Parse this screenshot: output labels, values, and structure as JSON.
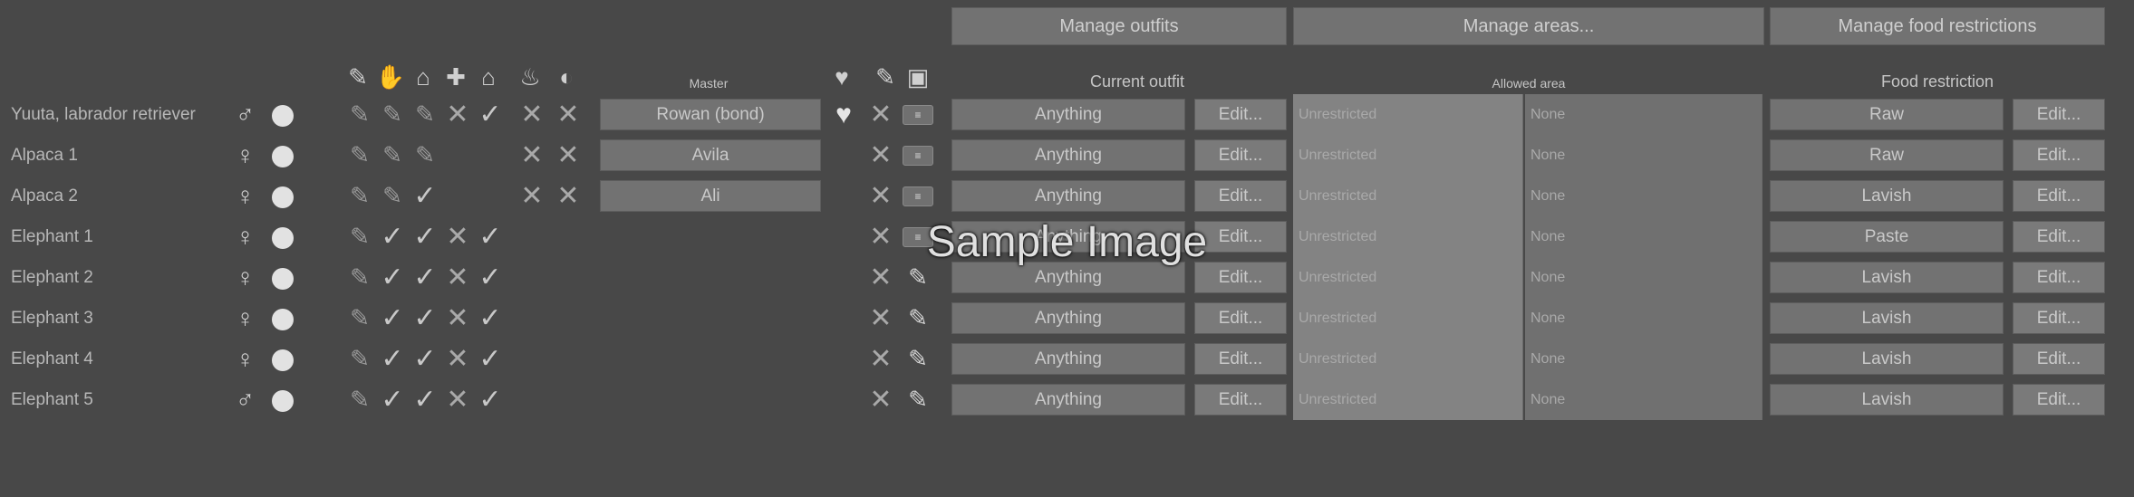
{
  "top_buttons": {
    "manage_outfits": "Manage outfits",
    "manage_areas": "Manage areas...",
    "manage_food": "Manage food restrictions"
  },
  "headers": {
    "master": "Master",
    "current_outfit": "Current outfit",
    "allowed_area": "Allowed area",
    "food_restriction": "Food restriction"
  },
  "header_icons": [
    "feather-icon",
    "hand-icon",
    "bed-icon",
    "plus-icon",
    "house-icon",
    "fire-icon",
    "egg-icon",
    "heart-icon",
    "pencil-icon",
    "tag-icon"
  ],
  "edit_label": "Edit...",
  "rows": [
    {
      "name": "Yuuta, labrador retriever",
      "gender": "♂",
      "marks": [
        "feather",
        "feather",
        "feather",
        "cross",
        "check",
        "cross",
        "cross"
      ],
      "master": "Rowan (bond)",
      "bond": true,
      "slaughter": "cross",
      "medical": "toggle",
      "outfit": "Anything",
      "area": "Unrestricted",
      "area_sub": "None",
      "food": "Raw"
    },
    {
      "name": "Alpaca 1",
      "gender": "♀",
      "marks": [
        "feather",
        "feather",
        "feather",
        "",
        "",
        "cross",
        "cross"
      ],
      "master": "Avila",
      "bond": false,
      "slaughter": "cross",
      "medical": "toggle",
      "outfit": "Anything",
      "area": "Unrestricted",
      "area_sub": "None",
      "food": "Raw"
    },
    {
      "name": "Alpaca 2",
      "gender": "♀",
      "marks": [
        "feather",
        "feather",
        "check",
        "",
        "",
        "cross",
        "cross"
      ],
      "master": "Ali",
      "bond": false,
      "slaughter": "cross",
      "medical": "toggle",
      "outfit": "Anything",
      "area": "Unrestricted",
      "area_sub": "None",
      "food": "Lavish"
    },
    {
      "name": "Elephant 1",
      "gender": "♀",
      "marks": [
        "feather",
        "check",
        "check",
        "cross",
        "check",
        "",
        ""
      ],
      "master": "",
      "bond": false,
      "slaughter": "cross",
      "medical": "toggle",
      "outfit": "Anything",
      "area": "Unrestricted",
      "area_sub": "None",
      "food": "Paste"
    },
    {
      "name": "Elephant 2",
      "gender": "♀",
      "marks": [
        "feather",
        "check",
        "check",
        "cross",
        "check",
        "",
        ""
      ],
      "master": "",
      "bond": false,
      "slaughter": "cross",
      "medical": "pen",
      "outfit": "Anything",
      "area": "Unrestricted",
      "area_sub": "None",
      "food": "Lavish"
    },
    {
      "name": "Elephant 3",
      "gender": "♀",
      "marks": [
        "feather",
        "check",
        "check",
        "cross",
        "check",
        "",
        ""
      ],
      "master": "",
      "bond": false,
      "slaughter": "cross",
      "medical": "pen",
      "outfit": "Anything",
      "area": "Unrestricted",
      "area_sub": "None",
      "food": "Lavish"
    },
    {
      "name": "Elephant 4",
      "gender": "♀",
      "marks": [
        "feather",
        "check",
        "check",
        "cross",
        "check",
        "",
        ""
      ],
      "master": "",
      "bond": false,
      "slaughter": "cross",
      "medical": "pen",
      "outfit": "Anything",
      "area": "Unrestricted",
      "area_sub": "None",
      "food": "Lavish"
    },
    {
      "name": "Elephant 5",
      "gender": "♂",
      "marks": [
        "feather",
        "check",
        "check",
        "cross",
        "check",
        "",
        ""
      ],
      "master": "",
      "bond": false,
      "slaughter": "cross",
      "medical": "pen",
      "outfit": "Anything",
      "area": "Unrestricted",
      "area_sub": "None",
      "food": "Lavish"
    }
  ],
  "watermark": "Sample Image"
}
